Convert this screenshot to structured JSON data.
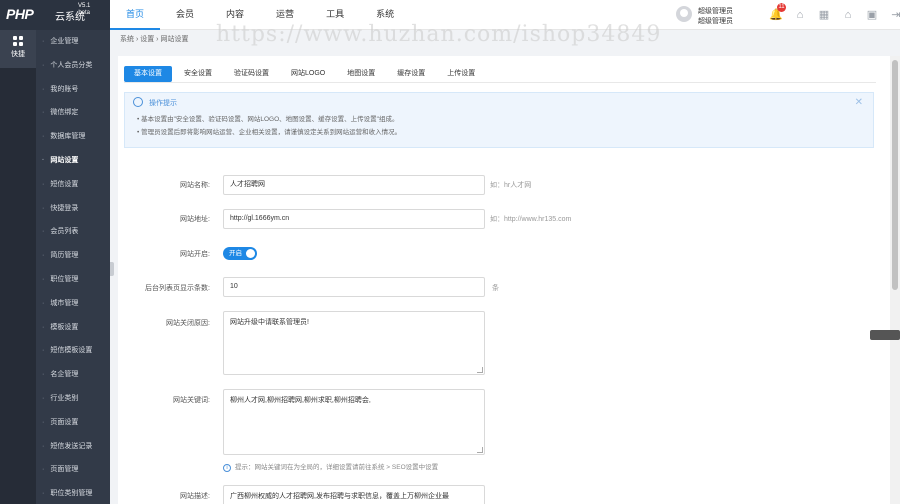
{
  "logo": {
    "brand": "PHP",
    "name": "云系统",
    "version": "V5.1",
    "edition": "beta"
  },
  "topnav": {
    "items": [
      "首页",
      "会员",
      "内容",
      "运营",
      "工具",
      "系统"
    ],
    "active": 0
  },
  "user": {
    "line1": "超级管理员",
    "line2": "超级管理员"
  },
  "notifications": {
    "count": "11"
  },
  "rail": {
    "label": "快捷"
  },
  "sidebar": {
    "items": [
      "企业管理",
      "个人会员分类",
      "我的账号",
      "微信绑定",
      "数据库管理",
      "网站设置",
      "短信设置",
      "快捷登录",
      "会员列表",
      "简历管理",
      "职位管理",
      "城市管理",
      "模板设置",
      "短信模板设置",
      "名企管理",
      "行业类别",
      "页面设置",
      "短信发送记录",
      "页面管理",
      "职位类别管理"
    ],
    "active": 5
  },
  "breadcrumb": "系统 › 设置 › 网站设置",
  "tabs": [
    "基本设置",
    "安全设置",
    "验证码设置",
    "网站LOGO",
    "地图设置",
    "缓存设置",
    "上传设置"
  ],
  "tip": {
    "title": "操作提示",
    "line1": "• 基本设置由\"安全设置、验证码设置、网站LOGO、地图设置、缓存设置、上传设置\"组成。",
    "line2": "• 管理员设置后即将影响网站运营、企业相关设置，请谨慎设定关系到网站运营和收入情况。"
  },
  "form": {
    "site_name": {
      "label": "网站名称:",
      "value": "人才招聘网",
      "hint": "如：hr人才网"
    },
    "site_url": {
      "label": "网站地址:",
      "value": "http://gl.1666ym.cn",
      "hint": "如：http://www.hr135.com"
    },
    "site_open": {
      "label": "网站开启:",
      "value": "开启"
    },
    "page_size": {
      "label": "后台列表页显示条数:",
      "value": "10",
      "unit": "条"
    },
    "close_msg": {
      "label": "网站关闭原因:",
      "value": "网站升级中请联系管理员!"
    },
    "keywords": {
      "label": "网站关键词:",
      "value": "柳州人才网,柳州招聘网,柳州求职,柳州招聘会,",
      "note": "提示：网站关键词在为全局的，详细设置请前往系统 > SEO设置中设置"
    },
    "description": {
      "label": "网站描述:",
      "value": "广西柳州权威的人才招聘网,发布招聘与求职信息，覆盖上万柳州企业最"
    }
  },
  "watermark": "https://www.huzhan.com/ishop34849"
}
